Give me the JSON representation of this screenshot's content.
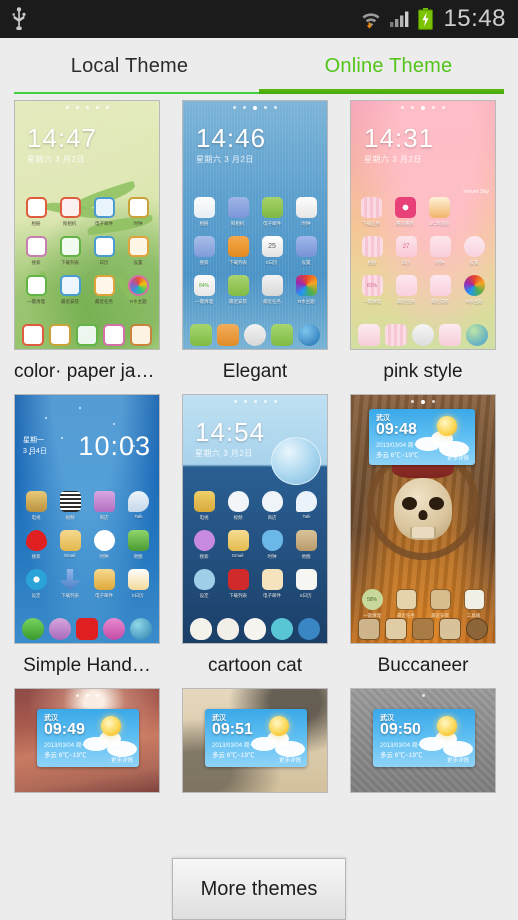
{
  "statusbar": {
    "time": "15:48",
    "icons": [
      "usb-icon",
      "wifi-icon",
      "signal-icon",
      "battery-charging-icon"
    ]
  },
  "tabs": {
    "local_label": "Local Theme",
    "online_label": "Online Theme",
    "active": "Online Theme",
    "accent_color": "#4cae12",
    "active_text_color": "#53c41a"
  },
  "themes": [
    {
      "title": "color· paper ja…",
      "clock": "14:47",
      "date": "星期六 3 月2日",
      "icon_labels_r1": [
        "相册",
        "照相机",
        "电子邮件",
        "时钟"
      ],
      "icon_labels_r2": [
        "搜索",
        "下载列表",
        "日历",
        "设置"
      ],
      "icon_labels_r3": [
        "一键清理",
        "最近安装",
        "最近任务",
        "R水主题"
      ],
      "battery_pct": "88%"
    },
    {
      "title": "Elegant",
      "clock": "14:46",
      "date": "星期六 3 月2日",
      "icon_labels_r1": [
        "相册",
        "照相机",
        "电子邮件",
        "时钟"
      ],
      "icon_labels_r2": [
        "搜索",
        "下载列表",
        "S日历",
        "设置"
      ],
      "icon_labels_r3": [
        "一键清理",
        "最近安装",
        "最近任务",
        "R水主题"
      ],
      "battery_pct": "84%",
      "calendar_day": "25"
    },
    {
      "title": "pink style",
      "clock": "14:31",
      "date": "星期六 3 月2日",
      "watermark": "Velvet Sky",
      "icon_labels_r1": [
        "下载应用",
        "腾讯重店",
        "UC浏览器"
      ],
      "icon_labels_r2": [
        "相册",
        "日历",
        "时钟",
        "设置"
      ],
      "icon_labels_r3": [
        "一键清理",
        "最近任务",
        "最近安装",
        "R水主题"
      ],
      "battery_pct": "81%",
      "calendar_day": "27"
    },
    {
      "title": "Simple Hand…",
      "clock": "10:03",
      "date_week": "星期一",
      "date_day": "3 月4日",
      "icon_labels_r1": [
        "电视",
        "视频",
        "商店",
        "Talk"
      ],
      "icon_labels_r2": [
        "搜索",
        "Gmail",
        "时钟",
        "地图"
      ],
      "icon_labels_r3": [
        "设定",
        "下载列表",
        "电子邮件",
        "S日历"
      ]
    },
    {
      "title": "cartoon cat",
      "clock": "14:54",
      "date": "星期六 3 月2日",
      "icon_labels_r1": [
        "电视",
        "视频",
        "商店",
        "Talk"
      ],
      "icon_labels_r2": [
        "搜索",
        "Gmail",
        "时钟",
        "地图"
      ],
      "icon_labels_r3": [
        "设定",
        "下载列表",
        "电子邮件",
        "S日历"
      ]
    },
    {
      "title": "Buccaneer",
      "widget": {
        "city": "武汉",
        "time": "09:48",
        "date": "2013/03/04 周一",
        "condition": "多云  6℃~19℃",
        "more": "更多详情"
      },
      "icon_labels_r3": [
        "一键清理",
        "最近任务",
        "最近安装",
        "工具箱"
      ],
      "battery_pct": "58%"
    },
    {
      "title": "",
      "widget": {
        "city": "武汉",
        "time": "09:49",
        "date": "2013/03/04 周一",
        "condition": "多云  6℃~19℃",
        "more": "更多详情"
      }
    },
    {
      "title": "",
      "widget": {
        "city": "武汉",
        "time": "09:51",
        "date": "2013/03/04 周一",
        "condition": "多云  6℃~19℃",
        "more": "更多详情"
      }
    },
    {
      "title": "",
      "widget": {
        "city": "武汉",
        "time": "09:50",
        "date": "2013/03/04 周一",
        "condition": "多云  6℃~19℃",
        "more": "更多详情"
      }
    }
  ],
  "footer": {
    "more_themes_label": "More themes"
  }
}
